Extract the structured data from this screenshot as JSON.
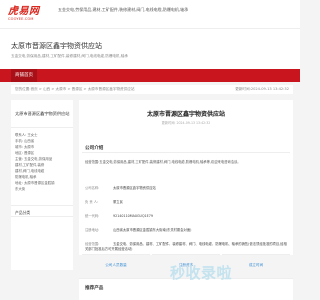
{
  "site": {
    "logo_text": "虎易网",
    "logo_sub": "COOYEE.COM",
    "tags": "五金交电,劳保用品,建材,工矿配件,装修建材,阀门,电线电缆,防爆电机,轴承"
  },
  "hero": {
    "title": "太原市晋源区鑫宇物资供应站",
    "desc": "五金交电,劳保用品,建材,工矿配件,装修建材,阀门,电线电缆,防爆电机,轴承"
  },
  "nav": {
    "items": [
      {
        "label": "商铺首页"
      }
    ]
  },
  "breadcrumb": {
    "path": "您的位置:首页 > 山西 > 太原市 > 晋源区 > 太原市晋源区鑫宇物资供应站",
    "time": "更新时间:2024-09-13 13:42:32"
  },
  "sidebar": {
    "title": "太原市晋源区鑫宇物资供应站",
    "info": [
      "联系人: 王女士",
      "手机: 山西省",
      "城市: 太原市",
      "地区: 晋源区",
      "主营: 五金交电,劳保用品",
      "建材,工矿配件,装修",
      "建材,阀门,电线电缆",
      "防爆电机,轴承",
      "地址: 太原市晋源区金胜镇",
      "东大街"
    ],
    "products_label": "产品分类"
  },
  "main": {
    "title": "太原市晋源区鑫宇物资供应站",
    "time": "更新时间: 2024-09-13 13:42:32",
    "company_section": "公司介绍",
    "intro": "经营范围:五金交电,劳保用品,建材,工矿配件,装修建材,阀门,电线电缆,防爆电机,轴承等,欢迎来电咨询洽谈。",
    "details": [
      {
        "k": "公司名称:",
        "v": "太原市晋源区鑫宇物资供应站"
      },
      {
        "k": "负 责 人:",
        "v": "董立民"
      },
      {
        "k": "统一代码:",
        "v": "92140110MA0GUQ1E79"
      },
      {
        "k": "注册地址:",
        "v": "山西省太原市晋源区金胜镇东大街南(东关村委会对面)"
      },
      {
        "k": "经营范围:",
        "v": "五金交电、劳保用品、建材、工矿配件、装修建材、阀门、电线电缆、防爆电机、轴承的销售(依法须经批准的项目,经相关部门批准后方可开展经营活动)"
      }
    ],
    "stats": [
      {
        "label": "公司人员数量"
      },
      {
        "label": "注册资本"
      },
      {
        "label": "成立时间"
      }
    ],
    "recommend_section": "推荐产品"
  },
  "watermark": "秒收录啦"
}
